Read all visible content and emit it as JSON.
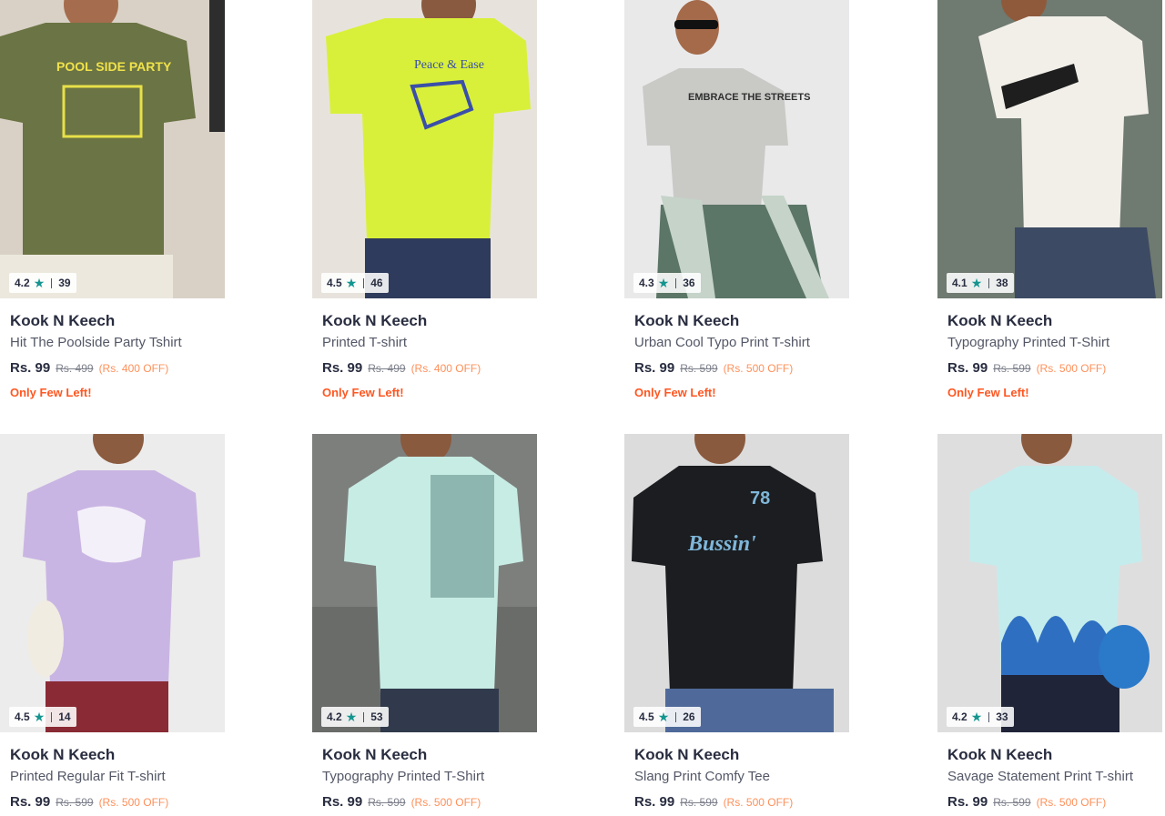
{
  "colors": {
    "rating_star": "#14958f",
    "discount": "#ff905a",
    "few_left": "#ff5722"
  },
  "products": [
    {
      "rating": "4.2",
      "count": "39",
      "brand": "Kook N Keech",
      "name": "Hit The Poolside Party Tshirt",
      "price": "Rs. 99",
      "mrp": "Rs. 499",
      "discount": "(Rs. 400 OFF)",
      "stock": "Only Few Left!",
      "tshirt_color": "#6b7444",
      "bg": "#d9d1c6",
      "print": "POOL SIDE PARTY"
    },
    {
      "rating": "4.5",
      "count": "46",
      "brand": "Kook N Keech",
      "name": "Printed T-shirt",
      "price": "Rs. 99",
      "mrp": "Rs. 499",
      "discount": "(Rs. 400 OFF)",
      "stock": "Only Few Left!",
      "tshirt_color": "#d9f03a",
      "bg": "#e7e3dc",
      "print": "Peace & Ease"
    },
    {
      "rating": "4.3",
      "count": "36",
      "brand": "Kook N Keech",
      "name": "Urban Cool Typo Print T-shirt",
      "price": "Rs. 99",
      "mrp": "Rs. 599",
      "discount": "(Rs. 500 OFF)",
      "stock": "Only Few Left!",
      "tshirt_color": "#c9cac6",
      "bg": "#e9e9ea",
      "print": "EMBRACE THE STREETS"
    },
    {
      "rating": "4.1",
      "count": "38",
      "brand": "Kook N Keech",
      "name": "Typography Printed T-Shirt",
      "price": "Rs. 99",
      "mrp": "Rs. 599",
      "discount": "(Rs. 500 OFF)",
      "stock": "Only Few Left!",
      "tshirt_color": "#f2efe9",
      "bg": "#6f7a70",
      "print": ""
    },
    {
      "rating": "4.5",
      "count": "14",
      "brand": "Kook N Keech",
      "name": "Printed Regular Fit T-shirt",
      "price": "Rs. 99",
      "mrp": "Rs. 599",
      "discount": "(Rs. 500 OFF)",
      "stock": "",
      "tshirt_color": "#c9b5e3",
      "bg": "#ececec",
      "print": ""
    },
    {
      "rating": "4.2",
      "count": "53",
      "brand": "Kook N Keech",
      "name": "Typography Printed T-Shirt",
      "price": "Rs. 99",
      "mrp": "Rs. 599",
      "discount": "(Rs. 500 OFF)",
      "stock": "",
      "tshirt_color": "#c7ece4",
      "bg": "#7d7f7d",
      "print": ""
    },
    {
      "rating": "4.5",
      "count": "26",
      "brand": "Kook N Keech",
      "name": "Slang Print Comfy Tee",
      "price": "Rs. 99",
      "mrp": "Rs. 599",
      "discount": "(Rs. 500 OFF)",
      "stock": "",
      "tshirt_color": "#1b1d20",
      "bg": "#dcdcdc",
      "print": "Bussin'"
    },
    {
      "rating": "4.2",
      "count": "33",
      "brand": "Kook N Keech",
      "name": "Savage Statement Print T-shirt",
      "price": "Rs. 99",
      "mrp": "Rs. 599",
      "discount": "(Rs. 500 OFF)",
      "stock": "",
      "tshirt_color": "#c5ecec",
      "bg": "#dedede",
      "print": ""
    }
  ]
}
